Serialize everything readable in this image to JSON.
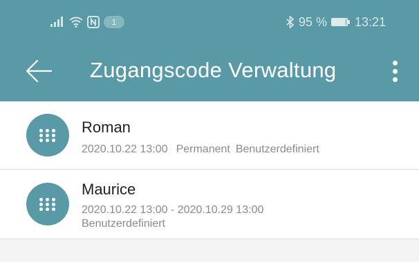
{
  "status_bar": {
    "signal_icon": "signal-bars-icon",
    "wifi_icon": "wifi-icon",
    "nfc_icon": "nfc-icon",
    "notification_count": "1",
    "bluetooth_icon": "bluetooth-icon",
    "battery": "95 %",
    "battery_level": 0.95,
    "time": "13:21"
  },
  "appbar": {
    "back_icon": "arrow-left-icon",
    "title": "Zugangscode Verwaltung",
    "menu_icon": "more-vert-icon"
  },
  "colors": {
    "primary": "#5a9aa7",
    "background": "#f4f4f4",
    "secondary_text": "#8a8a8a"
  },
  "codes": [
    {
      "icon": "keypad-icon",
      "name": "Roman",
      "date": "2020.10.22 13:00",
      "validity": "Permanent",
      "type": "Benutzerdefiniert"
    },
    {
      "icon": "keypad-icon",
      "name": "Maurice",
      "date_range": "2020.10.22 13:00 - 2020.10.29 13:00",
      "type": "Benutzerdefiniert"
    }
  ]
}
